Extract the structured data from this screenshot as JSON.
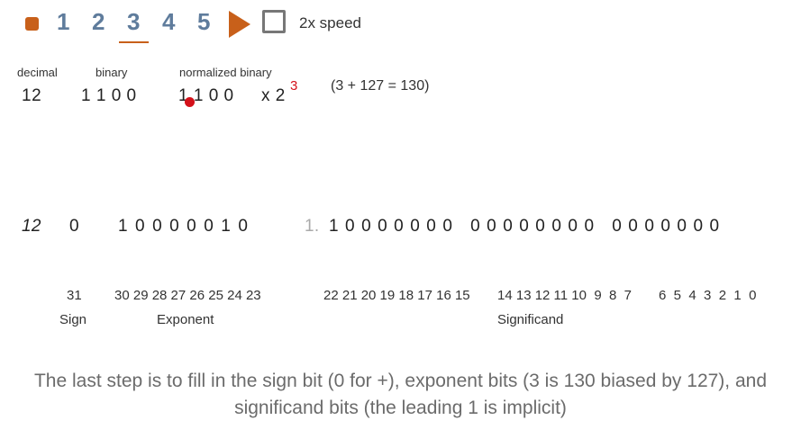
{
  "toolbar": {
    "steps": [
      "1",
      "2",
      "3",
      "4",
      "5"
    ],
    "active_step": "3",
    "speed_label": "2x speed"
  },
  "colors": {
    "accent": "#c8601a",
    "step_text": "#5f7c9c",
    "highlight_red": "#d4111a",
    "caption_gray": "#6b6b6b"
  },
  "header": {
    "decimal_label": "decimal",
    "binary_label": "binary",
    "normalized_label": "normalized binary",
    "decimal_value": "12",
    "binary_value": "1 1 0 0",
    "normalized_value": "1 1 0 0",
    "times_two": "x 2",
    "exponent": "3",
    "bias_calc": "(3 + 127 = 130)"
  },
  "bits_row": {
    "decimal": "12",
    "sign": "0",
    "exponent_bits": "1 0 0 0 0 0 1 0",
    "implicit_lead": "1.",
    "significand_bits": "1 0 0 0 0 0 0 0   0 0 0 0 0 0 0 0   0 0 0 0 0 0 0"
  },
  "indices": {
    "sign": "31",
    "exponent": "30 29 28 27 26 25 24 23",
    "sig_a": "22 21 20 19 18 17 16 15",
    "sig_b": "14 13 12 11 10  9  8  7",
    "sig_c": "6  5  4  3  2  1  0"
  },
  "sections": {
    "sign": "Sign",
    "exponent": "Exponent",
    "significand": "Significand"
  },
  "caption": "The last step is to fill in the sign bit (0 for +), exponent bits (3 is 130 biased by 127), and significand bits (the leading 1 is implicit)"
}
